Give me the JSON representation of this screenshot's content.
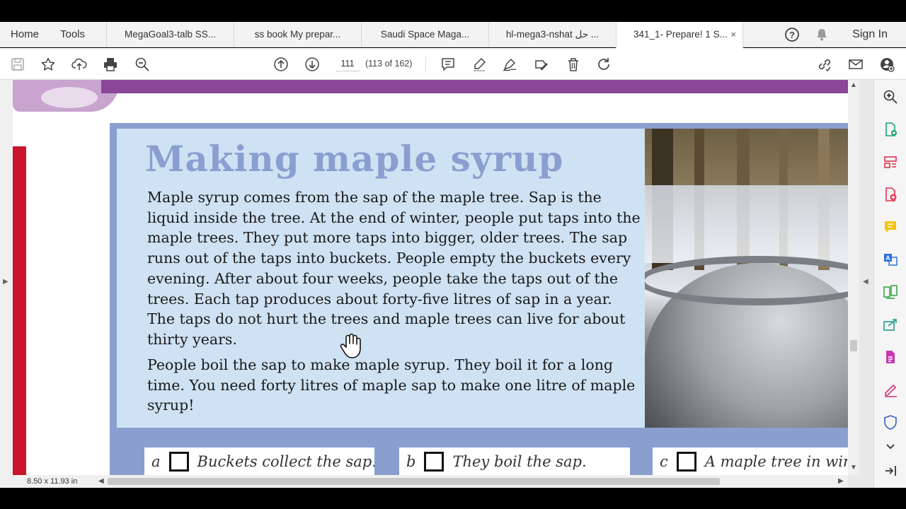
{
  "menu": {
    "home": "Home",
    "tools": "Tools"
  },
  "tabs": [
    {
      "label": "MegaGoal3-talb SS..."
    },
    {
      "label": "ss book My prepar..."
    },
    {
      "label": "Saudi Space Maga..."
    },
    {
      "label": "hl-mega3-nshat حل ..."
    },
    {
      "label": "341_1- Prepare! 1 S...",
      "close": "×"
    }
  ],
  "account": {
    "sign_in": "Sign In"
  },
  "navigation": {
    "page_input": "111",
    "page_count": "(113 of 162)"
  },
  "document": {
    "title": "Making maple syrup",
    "paragraph1": "Maple syrup comes from the sap of the maple tree. Sap is the liquid inside the tree. At the end of winter, people put taps into the maple trees. They put more taps into bigger, older trees. The sap runs out of the taps into buckets. People empty the buckets every evening. After about four weeks, people take the taps out of the trees. Each tap produces about forty-five litres of sap in a year. The taps do not hurt the trees and maple trees can live for about thirty years.",
    "paragraph2": "People boil the sap to make maple syrup. They boil it for a long time. You need forty litres of maple sap to make one litre of maple syrup!",
    "captions": [
      {
        "letter": "a",
        "text": "Buckets collect the sap."
      },
      {
        "letter": "b",
        "text": "They boil the sap."
      },
      {
        "letter": "c",
        "text": "A maple tree in winter."
      }
    ]
  },
  "status": {
    "page_size": "8.50 x 11.93 in"
  },
  "colors": {
    "accent_purple": "#8a4697",
    "panel_blue": "#8a9fd0",
    "panel_light": "#cfe2f3",
    "red_strip": "#c9162e"
  }
}
